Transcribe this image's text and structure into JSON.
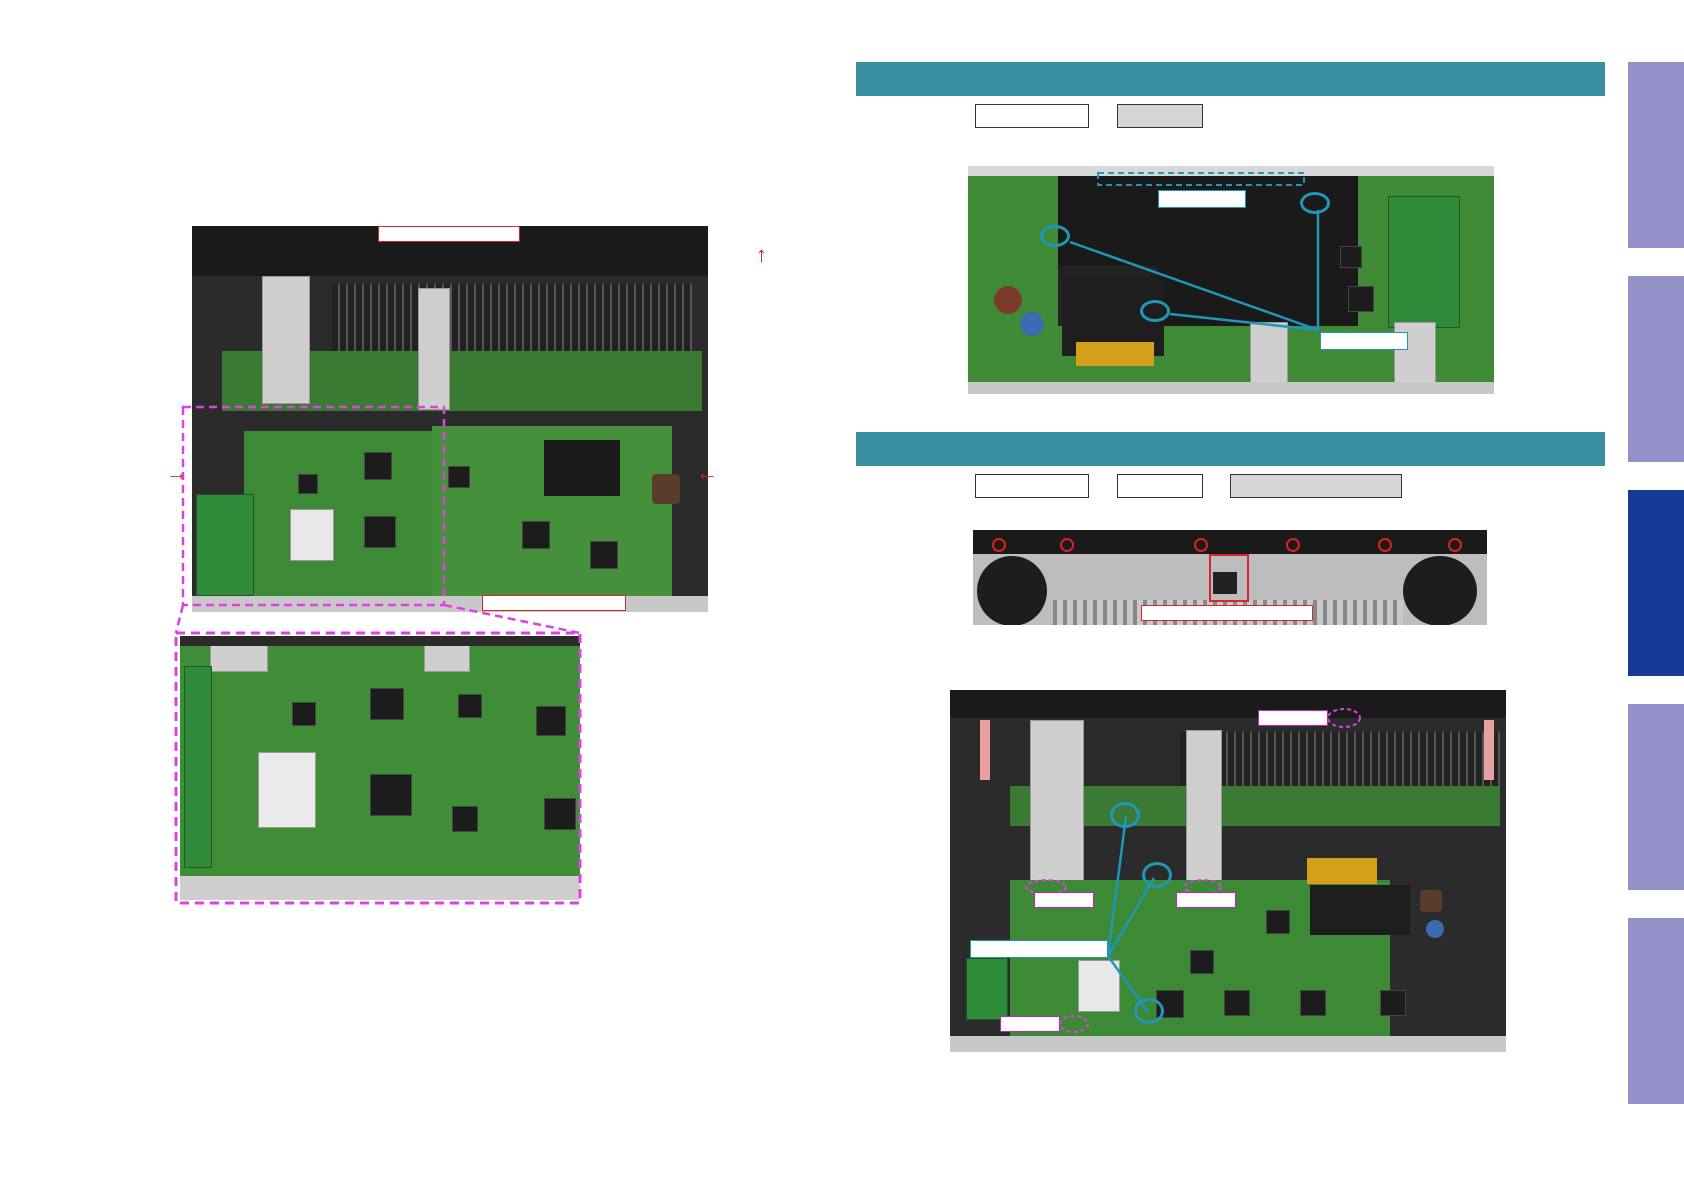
{
  "page": {
    "background": "#ffffff"
  },
  "colors": {
    "section_header": "#3a8f9e",
    "side_tab": "#9491c8",
    "side_tab_active": "#173a96",
    "callout_cyan": "#1f97b8",
    "callout_red": "#d22a2a",
    "callout_magenta": "#c81fc8",
    "arrow_red": "#d02020"
  },
  "icons": {
    "left_arrow": "→",
    "right_arrow": "←",
    "up_arrow": "↑"
  },
  "side_tabs": [
    {
      "active": false
    },
    {
      "active": false
    },
    {
      "active": true
    },
    {
      "active": false
    },
    {
      "active": false
    }
  ]
}
